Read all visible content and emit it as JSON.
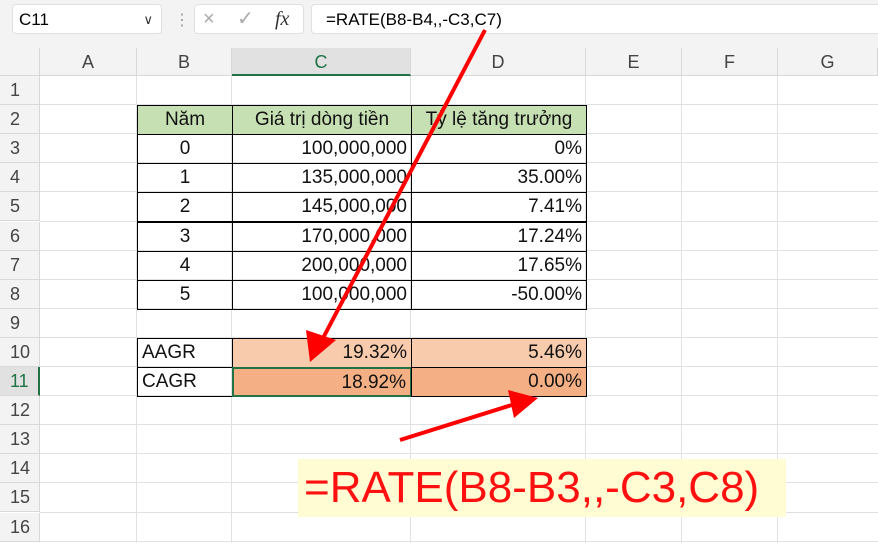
{
  "formula_bar": {
    "name_box": "C11",
    "formula": "=RATE(B8-B4,,-C3,C7)",
    "cancel_icon": "×",
    "enter_icon": "✓",
    "fx_label": "fx"
  },
  "columns": [
    "A",
    "B",
    "C",
    "D",
    "E",
    "F",
    "G"
  ],
  "rows": [
    "1",
    "2",
    "3",
    "4",
    "5",
    "6",
    "7",
    "8",
    "9",
    "10",
    "11",
    "12",
    "13",
    "14",
    "15",
    "16"
  ],
  "table": {
    "headers": [
      "Năm",
      "Giá trị dòng tiền",
      "Tỷ lệ tăng trưởng"
    ],
    "rows": [
      [
        "0",
        "100,000,000",
        "0%"
      ],
      [
        "1",
        "135,000,000",
        "35.00%"
      ],
      [
        "2",
        "145,000,000",
        "7.41%"
      ],
      [
        "3",
        "170,000,000",
        "17.24%"
      ],
      [
        "4",
        "200,000,000",
        "17.65%"
      ],
      [
        "5",
        "100,000,000",
        "-50.00%"
      ]
    ]
  },
  "summary": [
    {
      "label": "AAGR",
      "c": "19.32%",
      "d": "5.46%"
    },
    {
      "label": "CAGR",
      "c": "18.92%",
      "d": "0.00%"
    }
  ],
  "annotation": "=RATE(B8-B3,,-C3,C8)",
  "colors": {
    "header_fill": "#c6e0b4",
    "aagr_fill": "#f8cbad",
    "cagr_fill": "#f4b084",
    "arrow": "#ff0000"
  }
}
